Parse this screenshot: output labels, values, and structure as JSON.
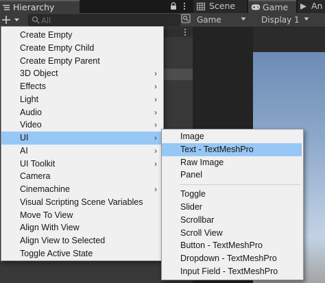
{
  "hierarchy": {
    "title": "Hierarchy",
    "search_placeholder": "All"
  },
  "view_tabs": [
    {
      "label": "Scene",
      "icon": "grid-icon"
    },
    {
      "label": "Game",
      "icon": "gamepad-icon",
      "active": true
    },
    {
      "label": "An",
      "icon": "animation-icon"
    }
  ],
  "game_toolbar": {
    "mode": "Game",
    "display": "Display 1"
  },
  "context_menu": {
    "items": [
      {
        "label": "Create Empty",
        "submenu": false
      },
      {
        "label": "Create Empty Child",
        "submenu": false
      },
      {
        "label": "Create Empty Parent",
        "submenu": false
      },
      {
        "label": "3D Object",
        "submenu": true
      },
      {
        "label": "Effects",
        "submenu": true
      },
      {
        "label": "Light",
        "submenu": true
      },
      {
        "label": "Audio",
        "submenu": true
      },
      {
        "label": "Video",
        "submenu": true
      },
      {
        "label": "UI",
        "submenu": true,
        "highlighted": true
      },
      {
        "label": "AI",
        "submenu": true
      },
      {
        "label": "UI Toolkit",
        "submenu": true
      },
      {
        "label": "Camera",
        "submenu": false
      },
      {
        "label": "Cinemachine",
        "submenu": true
      },
      {
        "label": "Visual Scripting Scene Variables",
        "submenu": false
      },
      {
        "label": "Move To View",
        "submenu": false
      },
      {
        "label": "Align With View",
        "submenu": false
      },
      {
        "label": "Align View to Selected",
        "submenu": false
      },
      {
        "label": "Toggle Active State",
        "submenu": false
      }
    ],
    "arrow_glyph": "›"
  },
  "ui_submenu": {
    "groups": [
      [
        {
          "label": "Image"
        },
        {
          "label": "Text - TextMeshPro",
          "highlighted": true
        },
        {
          "label": "Raw Image"
        },
        {
          "label": "Panel"
        }
      ],
      [
        {
          "label": "Toggle"
        },
        {
          "label": "Slider"
        },
        {
          "label": "Scrollbar"
        },
        {
          "label": "Scroll View"
        },
        {
          "label": "Button - TextMeshPro"
        },
        {
          "label": "Dropdown - TextMeshPro"
        },
        {
          "label": "Input Field - TextMeshPro"
        }
      ]
    ]
  },
  "colors": {
    "menu_bg": "#f0f0f0",
    "menu_highlight": "#97c7f4",
    "panel_bg": "#383838",
    "toolbar_bg": "#3c3c3c"
  }
}
